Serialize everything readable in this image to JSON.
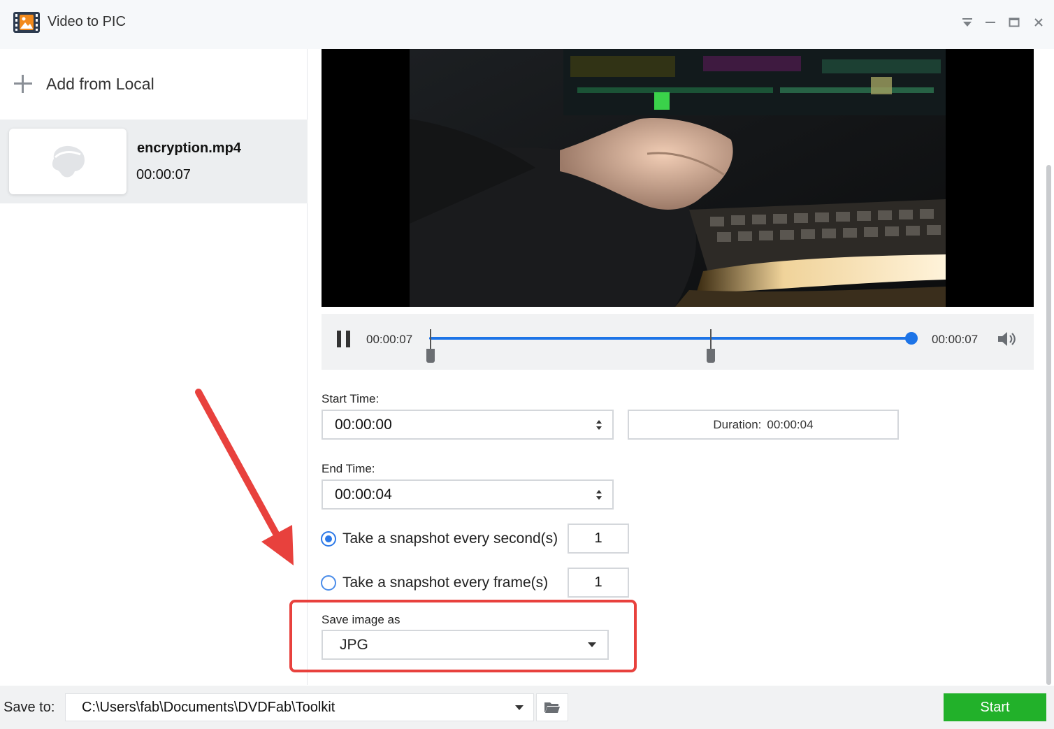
{
  "app": {
    "title": "Video to PIC",
    "icon": "film-photo-icon"
  },
  "window_controls": [
    "dropdown-icon",
    "minimize-icon",
    "maximize-icon",
    "close-icon"
  ],
  "sidebar": {
    "add_label": "Add from Local",
    "files": [
      {
        "name": "encryption.mp4",
        "duration": "00:00:07",
        "thumbnail_icon": "placeholder-image-icon"
      }
    ]
  },
  "player": {
    "current_time": "00:00:07",
    "total_time": "00:00:07",
    "progress": 1.0,
    "start_marker_fraction": 0.0,
    "end_marker_fraction": 0.57
  },
  "form": {
    "start_time_label": "Start Time:",
    "start_time_value": "00:00:00",
    "duration_label": "Duration:",
    "duration_value": "00:00:04",
    "end_time_label": "End Time:",
    "end_time_value": "00:00:04",
    "snapshot_seconds_label": "Take a snapshot every second(s)",
    "snapshot_seconds_value": "1",
    "snapshot_seconds_selected": true,
    "snapshot_frames_label": "Take a snapshot every frame(s)",
    "snapshot_frames_value": "1",
    "snapshot_frames_selected": false,
    "save_as_label": "Save image as",
    "save_as_value": "JPG"
  },
  "bottom": {
    "save_to_label": "Save to:",
    "save_path": "C:\\Users\\fab\\Documents\\DVDFab\\Toolkit",
    "start_label": "Start"
  },
  "colors": {
    "accent_blue": "#1d74e7",
    "start_green": "#22b12a",
    "annotation_red": "#e8413d"
  }
}
